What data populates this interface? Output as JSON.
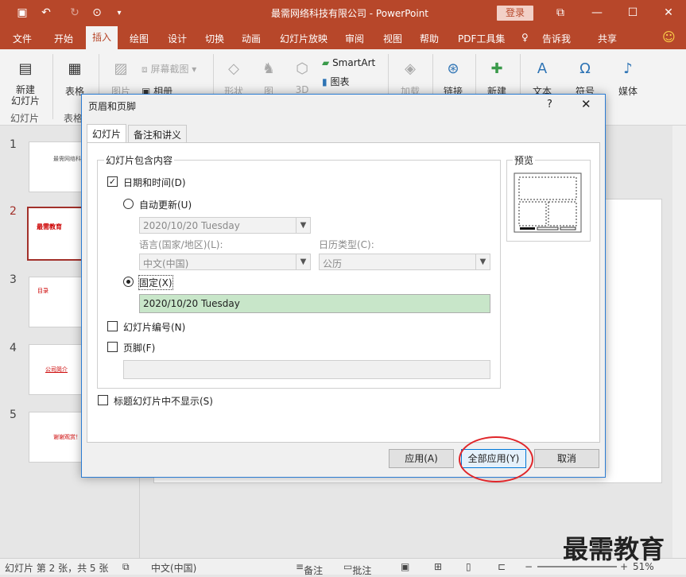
{
  "window": {
    "title": "最需网络科技有限公司 - PowerPoint",
    "login_label": "登录"
  },
  "ribbon_tabs": [
    "文件",
    "开始",
    "插入",
    "绘图",
    "设计",
    "切换",
    "动画",
    "幻灯片放映",
    "审阅",
    "视图",
    "帮助",
    "PDF工具集",
    "告诉我",
    "共享"
  ],
  "active_tab": "插入",
  "ribbon": {
    "new_slide": "新建\n幻灯片",
    "group_slides": "幻灯片",
    "table": "表格",
    "group_table": "表格",
    "images": "图片",
    "screenshot": "屏幕截图",
    "album": "相册",
    "shapes": "形状",
    "icons": "图",
    "models3d": "3D",
    "smartart": "SmartArt",
    "chart": "图表",
    "addins": "加载",
    "link": "链接",
    "new_comment": "新建",
    "text": "文本",
    "symbol": "符号",
    "media": "媒体"
  },
  "thumbnails": [
    {
      "num": "1",
      "text": "最需网络科技有"
    },
    {
      "num": "2",
      "text": "最需教育"
    },
    {
      "num": "3",
      "text": "目录"
    },
    {
      "num": "4",
      "text": "公司简介"
    },
    {
      "num": "5",
      "text": "谢谢观赏！"
    }
  ],
  "dialog": {
    "title": "页眉和页脚",
    "help": "?",
    "close": "✕",
    "tabs": [
      "幻灯片",
      "备注和讲义"
    ],
    "group_label": "幻灯片包含内容",
    "date_time_label": "日期和时间(D)",
    "date_time_checked": true,
    "auto_update_label": "自动更新(U)",
    "auto_update_value": "2020/10/20 Tuesday",
    "language_label": "语言(国家/地区)(L):",
    "language_value": "中文(中国)",
    "calendar_label": "日历类型(C):",
    "calendar_value": "公历",
    "fixed_label": "固定(X)",
    "fixed_value": "2020/10/20 Tuesday",
    "slide_number_label": "幻灯片编号(N)",
    "footer_label": "页脚(F)",
    "footer_value": "",
    "hide_title_label": "标题幻灯片中不显示(S)",
    "preview_label": "预览",
    "apply_label": "应用(A)",
    "apply_all_label": "全部应用(Y)",
    "cancel_label": "取消"
  },
  "status": {
    "slide_info": "幻灯片 第 2 张，共 5 张",
    "language": "中文(中国)",
    "notes": "备注",
    "comments": "批注",
    "zoom": "51%"
  },
  "watermark": "最需教育",
  "colors": {
    "accent": "#b7472a",
    "highlight_field": "#c8e6c9",
    "annotation": "#e0262a"
  }
}
